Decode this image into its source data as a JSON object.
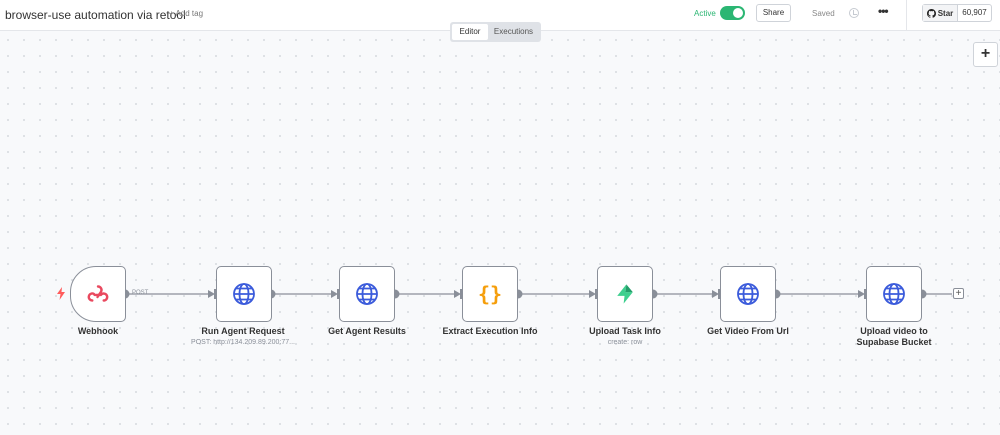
{
  "header": {
    "workflow_title": "browser-use automation via retool",
    "add_tag": "+ Add tag",
    "active_label": "Active",
    "share": "Share",
    "saved": "Saved",
    "more": "•••",
    "star": "Star",
    "star_count": "60,907"
  },
  "view_tabs": {
    "editor": "Editor",
    "executions": "Executions"
  },
  "canvas": {
    "zoom_add": "+",
    "edge_label": "POST",
    "end_plus": "+",
    "nodes": [
      {
        "label": "Webhook",
        "icon": "webhook-icon"
      },
      {
        "label": "Run Agent Request",
        "sub": "POST: http://134.209.89.200:77...",
        "icon": "globe-icon"
      },
      {
        "label": "Get Agent Results",
        "icon": "globe-icon"
      },
      {
        "label": "Extract Execution Info",
        "icon": "code-braces-icon",
        "glyph": "{}"
      },
      {
        "label": "Upload Task Info",
        "sub": "create: row",
        "icon": "supabase-icon"
      },
      {
        "label": "Get Video From Url",
        "icon": "globe-icon"
      },
      {
        "label": "Upload video to Supabase Bucket",
        "icon": "globe-icon"
      }
    ]
  },
  "colors": {
    "active": "#2bb673",
    "webhook": "#e9495f",
    "http": "#3b5bdb",
    "code": "#f59e0b",
    "supabase": "#3ecf8e",
    "trigger_bolt": "#ff5b5b"
  }
}
